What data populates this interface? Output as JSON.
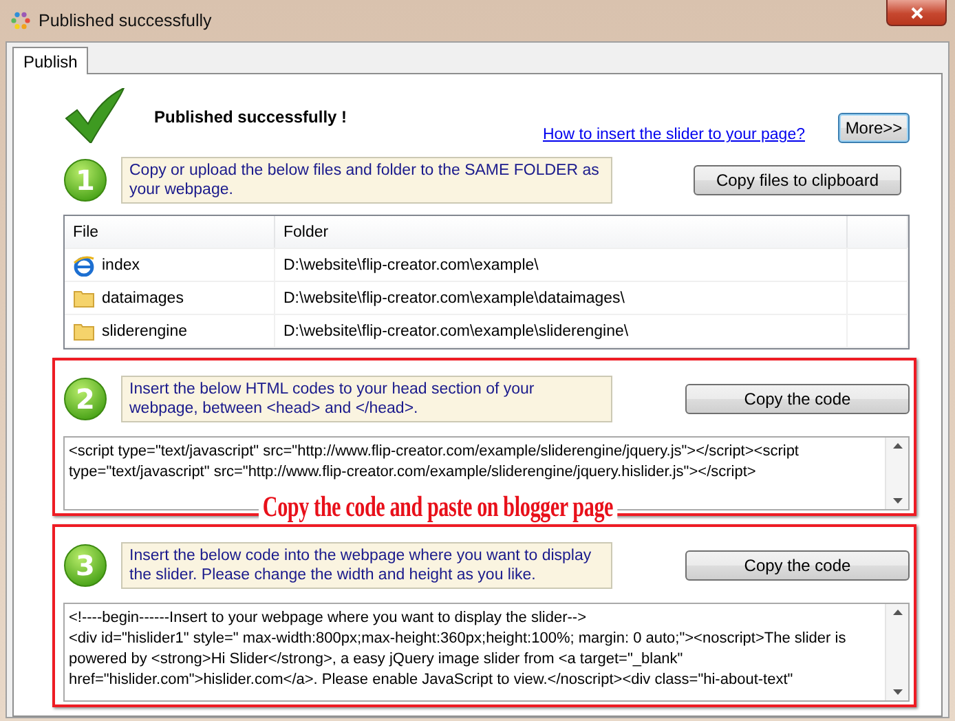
{
  "window": {
    "title": "Published successfully"
  },
  "tabs": [
    {
      "label": "Publish",
      "selected": true
    }
  ],
  "header": {
    "title": "Published successfully !",
    "help_link": "How to insert the slider to your page?",
    "more_button": "More>>"
  },
  "steps": [
    {
      "kind": "files",
      "number": "1",
      "instruction": "Copy or upload the below files and folder to the SAME FOLDER as your webpage.",
      "button": "Copy files to clipboard",
      "highlighted": false,
      "table": {
        "columns": [
          "File",
          "Folder"
        ],
        "rows": [
          {
            "kind": "page",
            "file": "index",
            "folder": "D:\\website\\flip-creator.com\\example\\"
          },
          {
            "kind": "folder",
            "file": "dataimages",
            "folder": "D:\\website\\flip-creator.com\\example\\dataimages\\"
          },
          {
            "kind": "folder",
            "file": "sliderengine",
            "folder": "D:\\website\\flip-creator.com\\example\\sliderengine\\"
          }
        ]
      }
    },
    {
      "kind": "code",
      "number": "2",
      "instruction": "Insert  the below HTML codes to your head section of your webpage, between <head> and </head>.",
      "button": "Copy the code",
      "highlighted": true,
      "code_lines": [
        "<script type=\"text/javascript\" src=\"http://www.flip-creator.com/example/sliderengine/jquery.js\"></script><script",
        "type=\"text/javascript\" src=\"http://www.flip-creator.com/example/sliderengine/jquery.hislider.js\"></script>"
      ]
    },
    {
      "kind": "code",
      "number": "3",
      "instruction": "Insert the below code into the webpage where you want to display the slider. Please change the width and height as you like.",
      "button": "Copy the code",
      "highlighted": true,
      "code_lines": [
        "<!----begin------Insert to your webpage where you want to display the slider-->",
        "<div id=\"hislider1\" style=\" max-width:800px;max-height:360px;height:100%; margin: 0 auto;\"><noscript>The slider is",
        "powered by <strong>Hi Slider</strong>, a easy jQuery image slider from <a target=\"_blank\"",
        "href=\"hislider.com\">hislider.com</a>. Please enable JavaScript to view.</noscript><div class=\"hi-about-text\""
      ]
    }
  ],
  "annotation": "Copy the code and paste on blogger page"
}
